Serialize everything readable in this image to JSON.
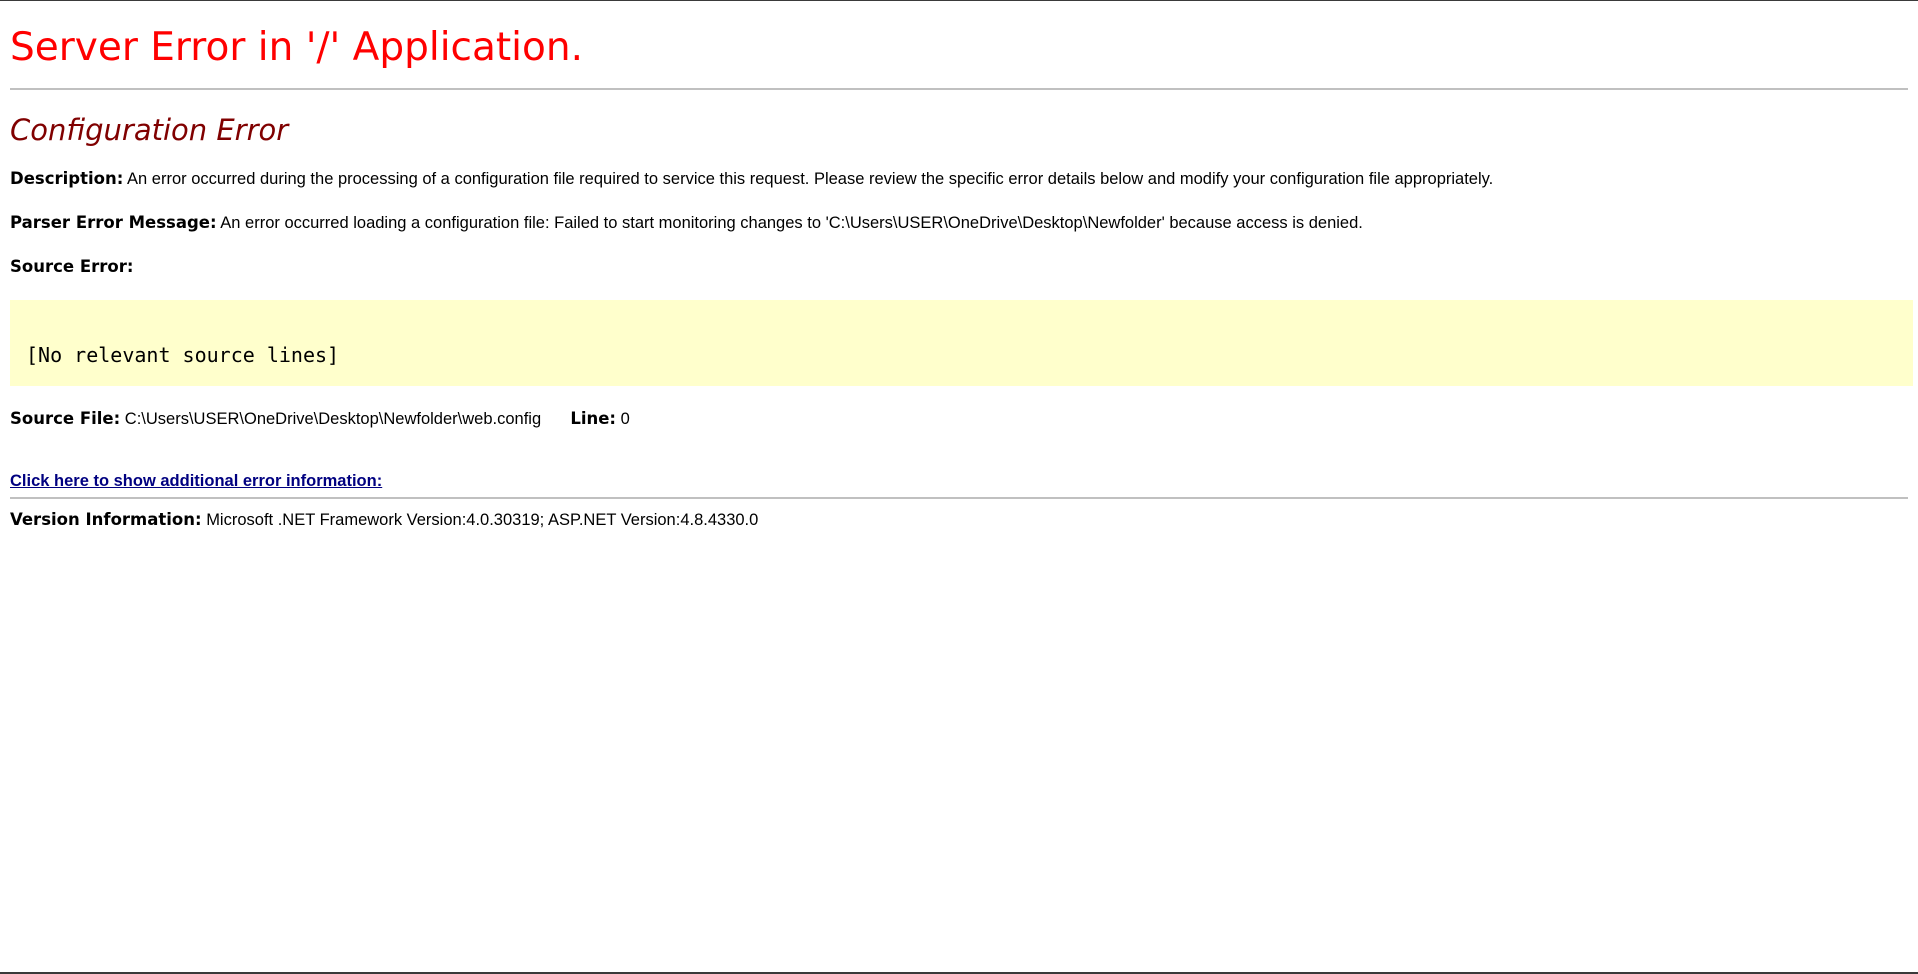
{
  "header": {
    "title": "Server Error in '/' Application."
  },
  "error": {
    "title": "Configuration Error",
    "description_label": "Description:",
    "description_text": "An error occurred during the processing of a configuration file required to service this request. Please review the specific error details below and modify your configuration file appropriately.",
    "parser_label": "Parser Error Message:",
    "parser_text": "An error occurred loading a configuration file: Failed to start monitoring changes to 'C:\\Users\\USER\\OneDrive\\Desktop\\Newfolder' because access is denied.",
    "source_error_label": "Source Error:",
    "source_lines": "[No relevant source lines]",
    "source_file_label": "Source File:",
    "source_file_path": "C:\\Users\\USER\\OneDrive\\Desktop\\Newfolder\\web.config",
    "line_label": "Line:",
    "line_value": "0",
    "more_info_link": "Click here to show additional error information:"
  },
  "version": {
    "label": "Version Information:",
    "text": "Microsoft .NET Framework Version:4.0.30319; ASP.NET Version:4.8.4330.0"
  },
  "colors": {
    "title": "#ff0000",
    "error_title": "#800000",
    "source_box": "#ffffcc",
    "link": "#000080"
  }
}
